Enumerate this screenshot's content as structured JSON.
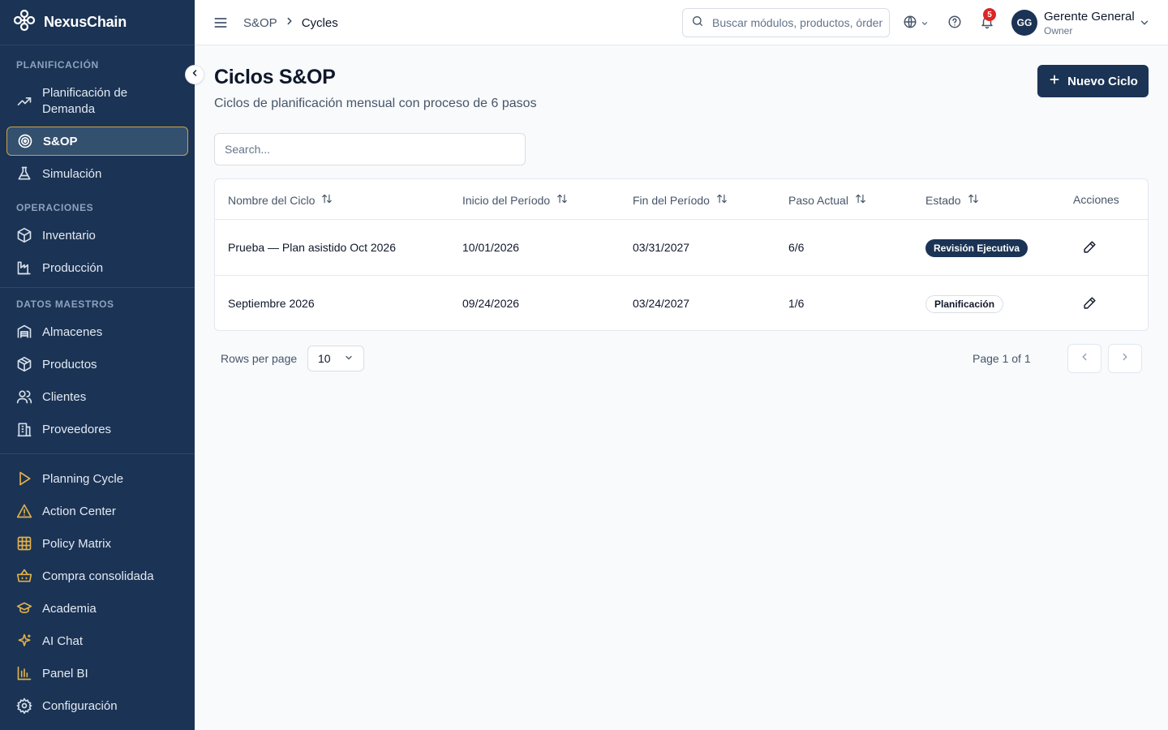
{
  "brand": {
    "name": "NexusChain"
  },
  "sidebar": {
    "sections": [
      {
        "title": "PLANIFICACIÓN"
      },
      {
        "title": "OPERACIONES"
      },
      {
        "title": "DATOS MAESTROS"
      }
    ],
    "items": [
      {
        "label": "Planificación de",
        "label2": "Demanda",
        "icon": "trending-up-icon"
      },
      {
        "label": "S&OP",
        "icon": "target-icon",
        "active": true
      },
      {
        "label": "Simulación",
        "icon": "flask-icon"
      },
      {
        "label": "Inventario",
        "icon": "box-icon"
      },
      {
        "label": "Producción",
        "icon": "factory-icon"
      },
      {
        "label": "Almacenes",
        "icon": "warehouse-icon"
      },
      {
        "label": "Productos",
        "icon": "package-icon"
      },
      {
        "label": "Clientes",
        "icon": "users-icon"
      },
      {
        "label": "Proveedores",
        "icon": "building-icon"
      },
      {
        "label": "Planning Cycle",
        "icon": "play-icon"
      },
      {
        "label": "Action Center",
        "icon": "alert-triangle-icon"
      },
      {
        "label": "Policy Matrix",
        "icon": "grid-icon"
      },
      {
        "label": "Compra consolidada",
        "icon": "basket-icon"
      },
      {
        "label": "Academia",
        "icon": "graduation-cap-icon"
      },
      {
        "label": "AI Chat",
        "icon": "sparkles-icon"
      },
      {
        "label": "Panel BI",
        "icon": "bar-chart-icon"
      },
      {
        "label": "Configuración",
        "icon": "settings-icon"
      }
    ],
    "accent_color": "#c9a24a"
  },
  "header": {
    "breadcrumb": {
      "root": "S&OP",
      "current": "Cycles"
    },
    "search_placeholder": "Buscar módulos, productos, órdenes...",
    "notifications_count": "5",
    "user": {
      "initials": "GG",
      "name": "Gerente General",
      "role": "Owner"
    }
  },
  "main": {
    "title": "Ciclos S&OP",
    "subtitle": "Ciclos de planificación mensual con proceso de 6 pasos",
    "new_button_label": "Nuevo Ciclo",
    "search_placeholder": "Search...",
    "table": {
      "columns": [
        "Nombre del Ciclo",
        "Inicio del Período",
        "Fin del Período",
        "Paso Actual",
        "Estado",
        "Acciones"
      ],
      "rows": [
        {
          "name": "Prueba — Plan asistido Oct 2026",
          "start": "10/01/2026",
          "end": "03/31/2027",
          "step": "6/6",
          "status": "Revisión Ejecutiva",
          "status_style": "dark"
        },
        {
          "name": "Septiembre 2026",
          "start": "09/24/2026",
          "end": "03/24/2027",
          "step": "1/6",
          "status": "Planificación",
          "status_style": "light"
        }
      ]
    },
    "pagination": {
      "rows_per_page_label": "Rows per page",
      "rows_per_page": "10",
      "page_info": "Page 1 of 1"
    }
  }
}
